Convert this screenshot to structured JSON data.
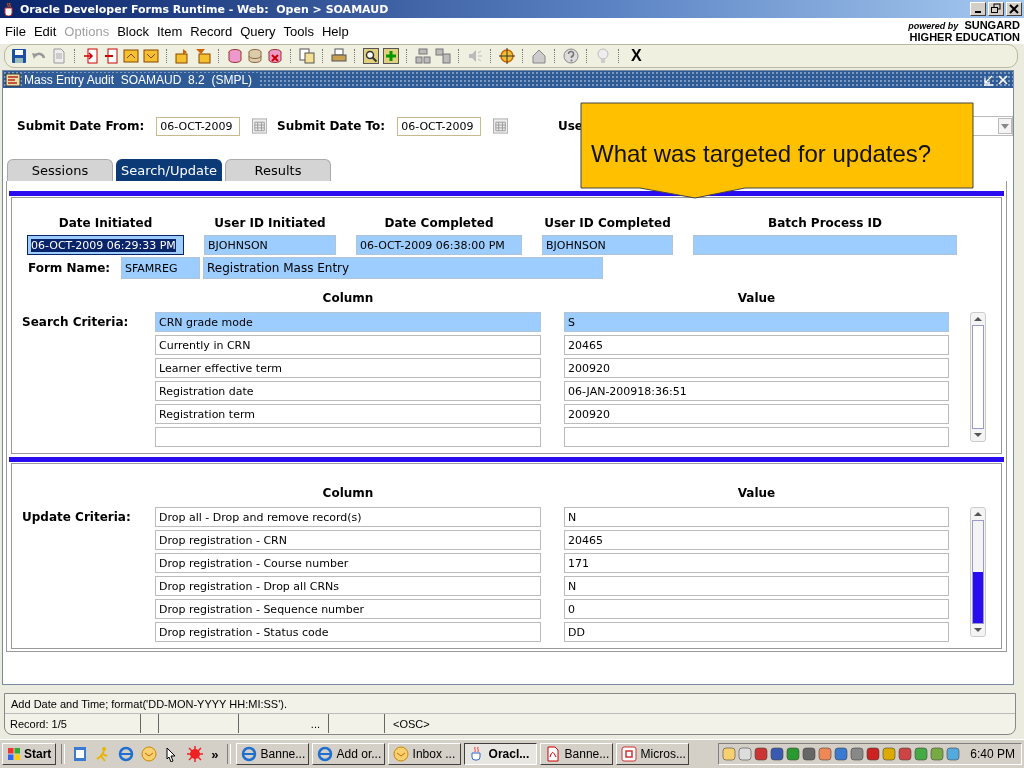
{
  "window": {
    "title": "Oracle Developer Forms Runtime - Web:  Open > SOAMAUD"
  },
  "menu": [
    {
      "label": "File",
      "disabled": false
    },
    {
      "label": "Edit",
      "disabled": false
    },
    {
      "label": "Options",
      "disabled": true
    },
    {
      "label": "Block",
      "disabled": false
    },
    {
      "label": "Item",
      "disabled": false
    },
    {
      "label": "Record",
      "disabled": false
    },
    {
      "label": "Query",
      "disabled": false
    },
    {
      "label": "Tools",
      "disabled": false
    },
    {
      "label": "Help",
      "disabled": false
    }
  ],
  "brand": {
    "powered_by": "powered by",
    "name": "SUNGARD",
    "subtitle": "HIGHER EDUCATION"
  },
  "toolbar": {
    "exit_label": "X"
  },
  "form": {
    "title": "Mass Entry Audit  SOAMAUD  8.2  (SMPL)",
    "submit_from_label": "Submit Date From:",
    "submit_from": "06-OCT-2009",
    "submit_to_label": "Submit Date To:",
    "submit_to": "06-OCT-2009",
    "user_label": "Use"
  },
  "tabs": [
    {
      "label": "Sessions",
      "selected": false
    },
    {
      "label": "Search/Update",
      "selected": true
    },
    {
      "label": "Results",
      "selected": false
    }
  ],
  "session": {
    "columns": [
      {
        "heading": "Date Initiated",
        "value": "06-OCT-2009 06:29:33 PM",
        "selected": true
      },
      {
        "heading": "User ID Initiated",
        "value": "BJOHNSON",
        "selected": false
      },
      {
        "heading": "Date Completed",
        "value": "06-OCT-2009 06:38:00 PM",
        "selected": false
      },
      {
        "heading": "User ID Completed",
        "value": "BJOHNSON",
        "selected": false
      },
      {
        "heading": "Batch Process ID",
        "selected": false
      }
    ],
    "form_name_label": "Form Name:",
    "form_code": "SFAMREG",
    "form_description": "Registration Mass Entry"
  },
  "search_criteria": {
    "label": "Search Criteria:",
    "column_heading": "Column",
    "value_heading": "Value",
    "rows": [
      {
        "column": "CRN grade mode",
        "value": "S",
        "selected": true
      },
      {
        "column": "Currently in CRN",
        "value": "20465",
        "selected": false
      },
      {
        "column": "Learner effective term",
        "value": "200920",
        "selected": false
      },
      {
        "column": "Registration date",
        "value": "06-JAN-200918:36:51",
        "selected": false
      },
      {
        "column": "Registration term",
        "value": "200920",
        "selected": false
      }
    ]
  },
  "update_criteria": {
    "label": "Update Criteria:",
    "column_heading": "Column",
    "value_heading": "Value",
    "rows": [
      {
        "column": "Drop all - Drop and remove record(s)",
        "value": "N",
        "selected": false
      },
      {
        "column": "Drop registration - CRN",
        "value": "20465",
        "selected": false
      },
      {
        "column": "Drop registration - Course number",
        "value": "171",
        "selected": false
      },
      {
        "column": "Drop registration - Drop all CRNs",
        "value": "N",
        "selected": false
      },
      {
        "column": "Drop registration - Sequence number",
        "value": "0",
        "selected": false
      },
      {
        "column": "Drop registration - Status code",
        "value": "DD",
        "selected": false
      }
    ]
  },
  "callout": {
    "text": "What was targeted for updates?"
  },
  "status_bar": {
    "message": "Add Date and Time; format('DD-MON-YYYY  HH:MI:SS').",
    "record": "Record: 1/5",
    "cell_4": "...",
    "mode": "<OSC>"
  },
  "taskbar": {
    "start": "Start",
    "more": "»",
    "tasks": [
      {
        "label": "Banne...",
        "kind": "browser",
        "selected": false
      },
      {
        "label": "Add or...",
        "kind": "browser",
        "selected": false
      },
      {
        "label": "Inbox ...",
        "kind": "mail",
        "selected": false
      },
      {
        "label": "Oracl...",
        "kind": "java",
        "selected": true
      },
      {
        "label": "Banne...",
        "kind": "pdf",
        "selected": false
      },
      {
        "label": "Micros...",
        "kind": "app",
        "selected": false
      }
    ],
    "clock": "6:40 PM"
  }
}
